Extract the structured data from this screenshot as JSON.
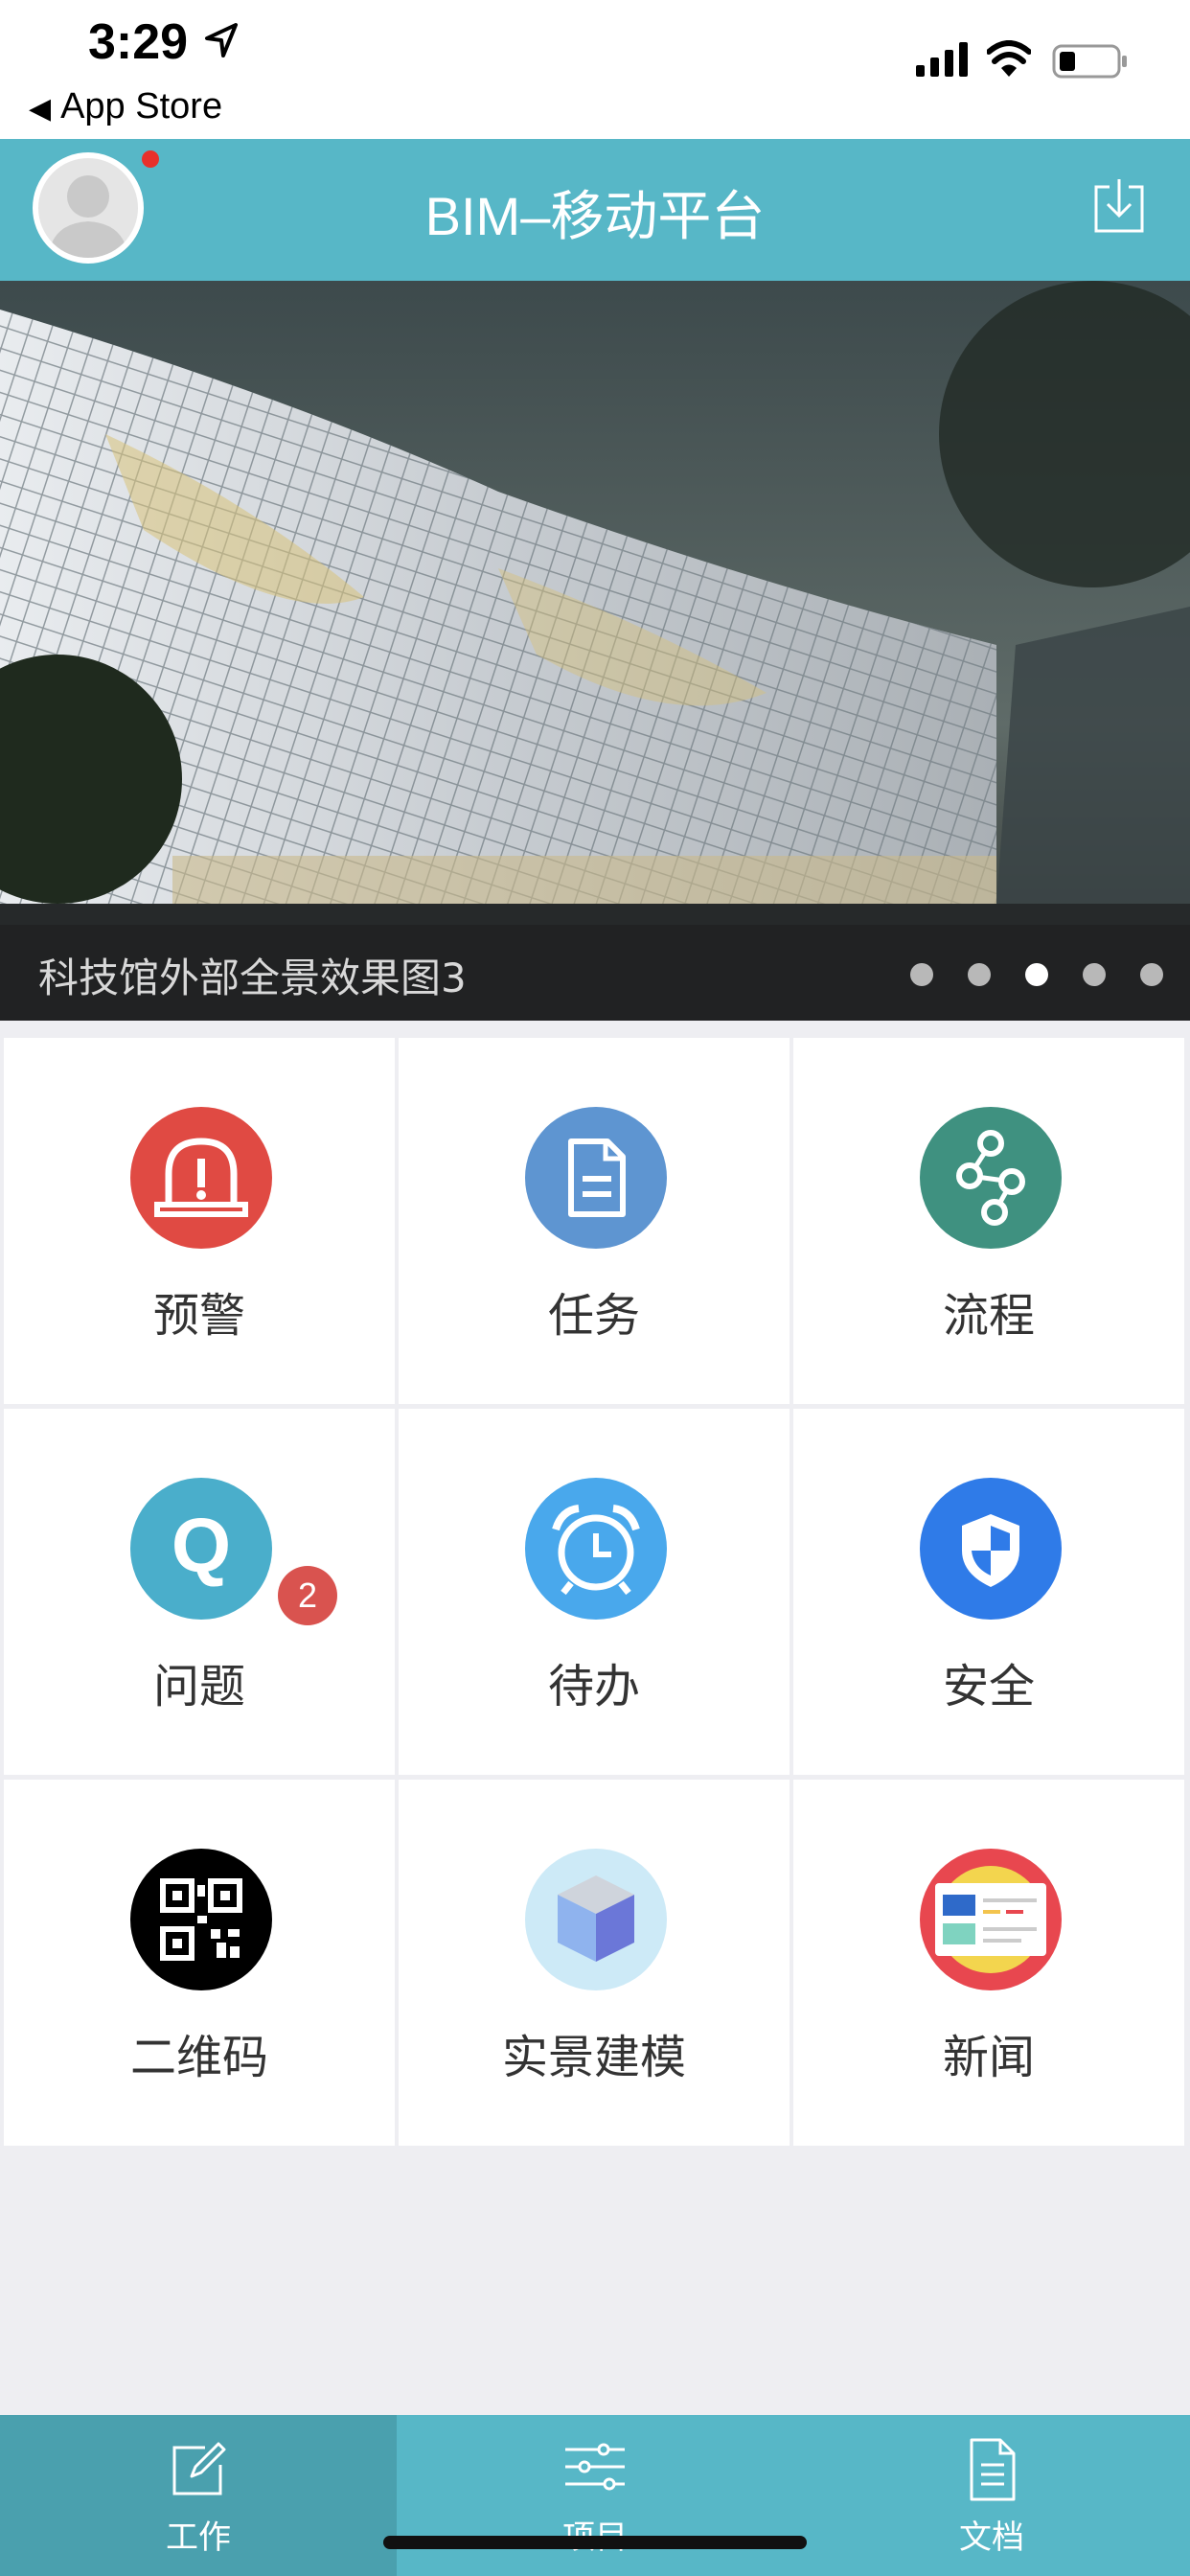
{
  "status_bar": {
    "time": "3:29",
    "back_label": "App Store",
    "icons": [
      "location-arrow-icon",
      "signal-icon",
      "wifi-icon",
      "battery-icon"
    ]
  },
  "header": {
    "title": "BIM–移动平台",
    "avatar_has_notification": true,
    "icons": [
      "avatar",
      "download-icon"
    ],
    "colors": {
      "bar": "#57b7c7",
      "notification_dot": "#e8312b"
    }
  },
  "banner": {
    "caption": "科技馆外部全景效果图3",
    "slide_count": 5,
    "active_slide": 3
  },
  "grid": {
    "items": [
      {
        "label": "预警",
        "icon": "alarm-warning-icon",
        "color": "#e04a43"
      },
      {
        "label": "任务",
        "icon": "document-icon",
        "color": "#5e95d1"
      },
      {
        "label": "流程",
        "icon": "workflow-icon",
        "color": "#3f9180"
      },
      {
        "label": "问题",
        "icon": "question-q-icon",
        "color": "#4aaecb",
        "badge": "2"
      },
      {
        "label": "待办",
        "icon": "alarm-clock-icon",
        "color": "#49a8ec"
      },
      {
        "label": "安全",
        "icon": "shield-icon",
        "color": "#2f7be8"
      },
      {
        "label": "二维码",
        "icon": "qr-code-icon",
        "color": "#000000"
      },
      {
        "label": "实景建模",
        "icon": "cube-icon",
        "color": "#cdeaf7"
      },
      {
        "label": "新闻",
        "icon": "news-icon",
        "color": "#e8474f"
      }
    ]
  },
  "tabbar": {
    "tabs": [
      {
        "label": "工作",
        "icon": "edit-icon",
        "active": true
      },
      {
        "label": "项目",
        "icon": "sliders-icon",
        "active": false
      },
      {
        "label": "文档",
        "icon": "document-icon",
        "active": false
      }
    ]
  }
}
